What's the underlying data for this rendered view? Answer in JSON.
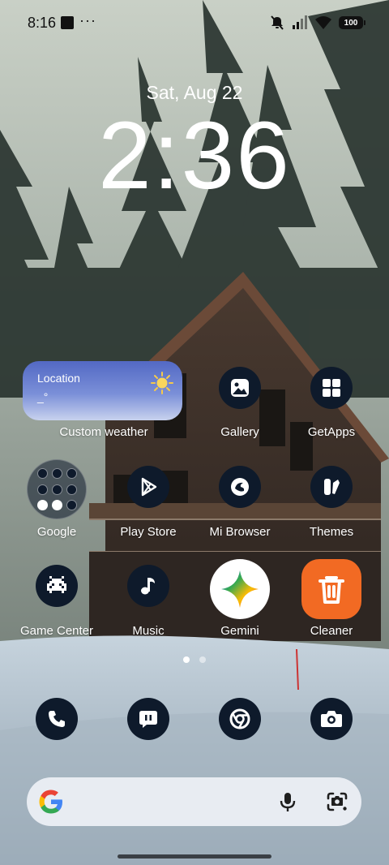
{
  "status_bar": {
    "time": "8:16",
    "dots": "···",
    "battery": "100",
    "icons": [
      "notification-square-icon",
      "mute-icon",
      "signal-icon",
      "wifi-icon",
      "battery-icon"
    ]
  },
  "clock": {
    "date": "Sat, Aug 22",
    "time": "2:36"
  },
  "weather_widget": {
    "location": "Location",
    "temperature": "_°",
    "label": "Custom weather",
    "icon": "sun-icon"
  },
  "apps": [
    {
      "label": "Gallery",
      "icon": "gallery-icon"
    },
    {
      "label": "GetApps",
      "icon": "getapps-icon"
    },
    {
      "label": "Google",
      "icon": "google-folder-icon"
    },
    {
      "label": "Play Store",
      "icon": "play-store-icon"
    },
    {
      "label": "Mi Browser",
      "icon": "browser-icon"
    },
    {
      "label": "Themes",
      "icon": "themes-icon"
    },
    {
      "label": "Game Center",
      "icon": "game-center-icon"
    },
    {
      "label": "Music",
      "icon": "music-icon"
    },
    {
      "label": "Gemini",
      "icon": "gemini-icon"
    },
    {
      "label": "Cleaner",
      "icon": "cleaner-icon"
    }
  ],
  "page_indicator": {
    "pages": 2,
    "current": 1
  },
  "dock": [
    {
      "icon": "phone-icon"
    },
    {
      "icon": "messages-icon"
    },
    {
      "icon": "chrome-icon"
    },
    {
      "icon": "camera-icon"
    }
  ],
  "search_bar": {
    "placeholder": "",
    "icons": [
      "google-g-icon",
      "microphone-icon",
      "google-lens-icon"
    ]
  },
  "colors": {
    "icon_bg": "#0e1a2b",
    "widget_top": "#5369c4",
    "widget_bottom": "#c8d2ee",
    "cleaner_orange": "#f26a23",
    "search_bg": "#e8ecf2"
  }
}
